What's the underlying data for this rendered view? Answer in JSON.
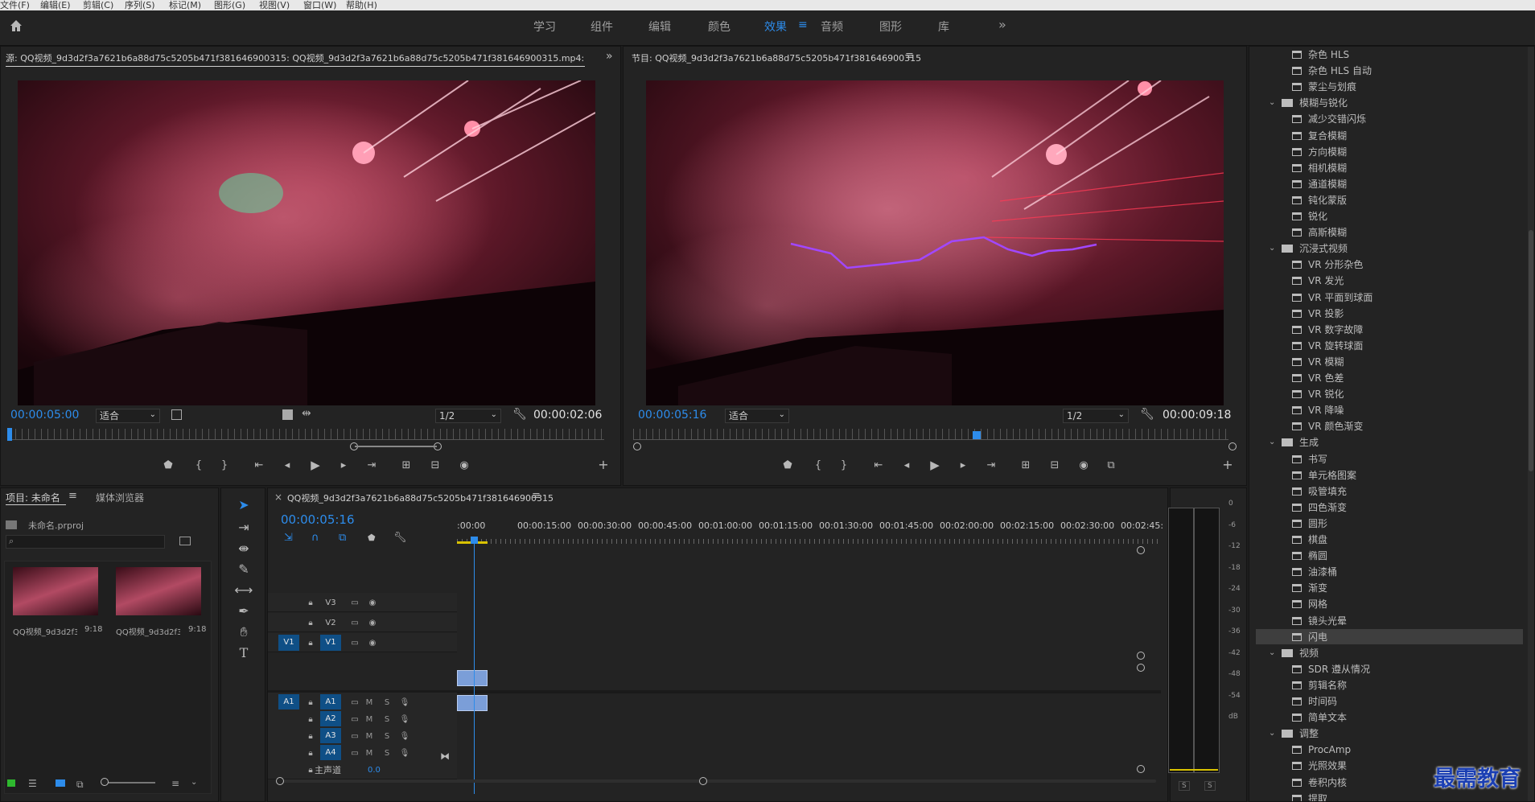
{
  "menu": [
    "文件(F)",
    "编辑(E)",
    "剪辑(C)",
    "序列(S)",
    "标记(M)",
    "图形(G)",
    "视图(V)",
    "窗口(W)",
    "帮助(H)"
  ],
  "workspaces": {
    "tabs": [
      "学习",
      "组件",
      "编辑",
      "颜色",
      "效果",
      "音频",
      "图形",
      "库"
    ],
    "active": "效果",
    "more": "»"
  },
  "source": {
    "title": "源: QQ视频_9d3d2f3a7621b6a88d75c5205b471f381646900315:  QQ视频_9d3d2f3a7621b6a88d75c5205b471f381646900315.mp4: 00:00:05:00",
    "timecode": "00:00:05:00",
    "fit": "适合",
    "resolution": "1/2",
    "duration": "00:00:02:06",
    "more": "»"
  },
  "program": {
    "title": "节目: QQ视频_9d3d2f3a7621b6a88d75c5205b471f381646900315",
    "timecode": "00:00:05:16",
    "fit": "适合",
    "resolution": "1/2",
    "duration": "00:00:09:18"
  },
  "effects": {
    "items": [
      {
        "t": "item",
        "label": "杂色 HLS"
      },
      {
        "t": "item",
        "label": "杂色 HLS 自动"
      },
      {
        "t": "item",
        "label": "蒙尘与划痕"
      },
      {
        "t": "cat",
        "label": "模糊与锐化"
      },
      {
        "t": "item",
        "label": "减少交错闪烁"
      },
      {
        "t": "item",
        "label": "复合模糊"
      },
      {
        "t": "item",
        "label": "方向模糊"
      },
      {
        "t": "item",
        "label": "相机模糊"
      },
      {
        "t": "item",
        "label": "通道模糊"
      },
      {
        "t": "item",
        "label": "钝化蒙版"
      },
      {
        "t": "item",
        "label": "锐化"
      },
      {
        "t": "item",
        "label": "高斯模糊"
      },
      {
        "t": "cat",
        "label": "沉浸式视频"
      },
      {
        "t": "item",
        "label": "VR 分形杂色"
      },
      {
        "t": "item",
        "label": "VR 发光"
      },
      {
        "t": "item",
        "label": "VR 平面到球面"
      },
      {
        "t": "item",
        "label": "VR 投影"
      },
      {
        "t": "item",
        "label": "VR 数字故障"
      },
      {
        "t": "item",
        "label": "VR 旋转球面"
      },
      {
        "t": "item",
        "label": "VR 模糊"
      },
      {
        "t": "item",
        "label": "VR 色差"
      },
      {
        "t": "item",
        "label": "VR 锐化"
      },
      {
        "t": "item",
        "label": "VR 降噪"
      },
      {
        "t": "item",
        "label": "VR 颜色渐变"
      },
      {
        "t": "cat",
        "label": "生成"
      },
      {
        "t": "item",
        "label": "书写"
      },
      {
        "t": "item",
        "label": "单元格图案"
      },
      {
        "t": "item",
        "label": "吸管填充"
      },
      {
        "t": "item",
        "label": "四色渐变"
      },
      {
        "t": "item",
        "label": "圆形"
      },
      {
        "t": "item",
        "label": "棋盘"
      },
      {
        "t": "item",
        "label": "椭圆"
      },
      {
        "t": "item",
        "label": "油漆桶"
      },
      {
        "t": "item",
        "label": "渐变"
      },
      {
        "t": "item",
        "label": "网格"
      },
      {
        "t": "item",
        "label": "镜头光晕"
      },
      {
        "t": "item",
        "label": "闪电",
        "selected": true
      },
      {
        "t": "cat",
        "label": "视频"
      },
      {
        "t": "item",
        "label": "SDR 遵从情况"
      },
      {
        "t": "item",
        "label": "剪辑名称"
      },
      {
        "t": "item",
        "label": "时间码"
      },
      {
        "t": "item",
        "label": "简单文本"
      },
      {
        "t": "cat",
        "label": "调整"
      },
      {
        "t": "item",
        "label": "ProcAmp"
      },
      {
        "t": "item",
        "label": "光照效果"
      },
      {
        "t": "item",
        "label": "卷积内核"
      },
      {
        "t": "item",
        "label": "提取"
      }
    ]
  },
  "project": {
    "tab_project": "项目: 未命名",
    "tab_media": "媒体浏览器",
    "file": "未命名.prproj",
    "clips": [
      {
        "name": "QQ视频_9d3d2f3...",
        "dur": "9:18"
      },
      {
        "name": "QQ视频_9d3d2f3...",
        "dur": "9:18"
      }
    ]
  },
  "timeline": {
    "close": "×",
    "title": "QQ视频_9d3d2f3a7621b6a88d75c5205b471f381646900315",
    "timecode": "00:00:05:16",
    "ruler": [
      ":00:00",
      "00:00:15:00",
      "00:00:30:00",
      "00:00:45:00",
      "00:01:00:00",
      "00:01:15:00",
      "00:01:30:00",
      "00:01:45:00",
      "00:02:00:00",
      "00:02:15:00",
      "00:02:30:00",
      "00:02:45:"
    ],
    "video_tracks": [
      "V3",
      "V2",
      "V1"
    ],
    "audio_tracks": [
      "A1",
      "A2",
      "A3",
      "A4"
    ],
    "src_v": "V1",
    "src_a": "A1",
    "m": "M",
    "s": "S",
    "master": "主声道",
    "master_val": "0.0"
  },
  "meter": {
    "ticks": [
      "0",
      "-6",
      "-12",
      "-18",
      "-24",
      "-30",
      "-36",
      "-42",
      "-48",
      "-54",
      "dB"
    ],
    "s1": "S",
    "s2": "S"
  },
  "watermark": "最需教育",
  "colors": {
    "accent": "#2d8ceb",
    "track": "#0f4f86",
    "clip": "#7b9ed8",
    "lightning": "#a147ff"
  }
}
